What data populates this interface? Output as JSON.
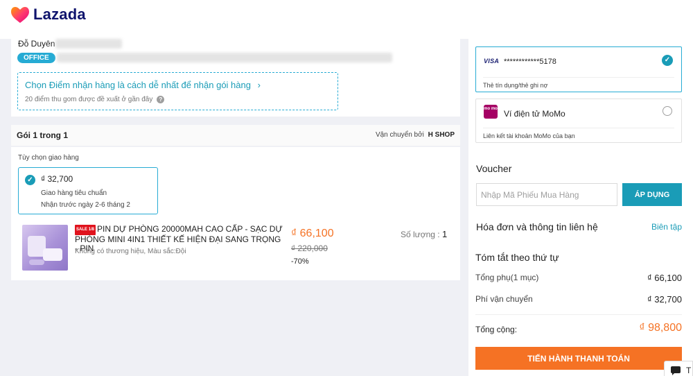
{
  "header": {
    "logo_text": "Lazada"
  },
  "address": {
    "recipient_name": "Đỗ Duyên",
    "address_tag": "OFFICE",
    "pickup_link": "Chọn Điểm nhận hàng là cách dễ nhất để nhận gói hàng",
    "pickup_hint": "20 điểm thu gom được đề xuất ở gần đây"
  },
  "package": {
    "title": "Gói 1 trong 1",
    "shipping_by_label": "Vận chuyển bởi",
    "shop_name": "H SHOP",
    "delivery_option_label": "Tùy chọn giao hàng",
    "option": {
      "price": "₫ 32,700",
      "name": "Giao hàng tiêu chuẩn",
      "eta": "Nhận trước ngày 2-6 tháng 2"
    },
    "product": {
      "sale_tag": "SALE 1/8",
      "title": "PIN DỰ PHÒNG 20000MAH CAO CẤP - SẠC DỰ PHÒNG MINI 4IN1 THIẾT KẾ HIỆN ĐẠI SANG TRỌNG - PIN",
      "variant": "Không có thương hiệu, Màu sắc:Đội",
      "price": "₫ 66,100",
      "original_price": "₫ 220,000",
      "discount": "-70%",
      "quantity_label": "Số lượng :",
      "quantity": "1"
    }
  },
  "payment": {
    "card": {
      "brand": "VISA",
      "number": "************5178",
      "subtitle": "Thẻ tín dụng/thẻ ghi nợ"
    },
    "momo": {
      "logo": "mo mo",
      "name": "Ví điện tử MoMo",
      "subtitle": "Liên kết tài khoản MoMo của bạn"
    }
  },
  "voucher": {
    "title": "Voucher",
    "placeholder": "Nhập Mã Phiếu Mua Hàng",
    "apply_label": "ÁP DỤNG"
  },
  "invoice": {
    "title": "Hóa đơn và thông tin liên hệ",
    "edit_label": "Biên tập"
  },
  "summary": {
    "title": "Tóm tắt theo thứ tự",
    "subtotal_label": "Tổng phụ(1 mục)",
    "subtotal_value": "₫ 66,100",
    "shipping_label": "Phí vận chuyển",
    "shipping_value": "₫ 32,700",
    "total_label": "Tổng cộng:",
    "total_value": "₫ 98,800",
    "checkout_label": "TIẾN HÀNH THANH TOÁN"
  },
  "chat": {
    "label": "T"
  },
  "colors": {
    "accent": "#1a9cb7",
    "orange": "#f57224",
    "brand_dark": "#0f146d"
  }
}
